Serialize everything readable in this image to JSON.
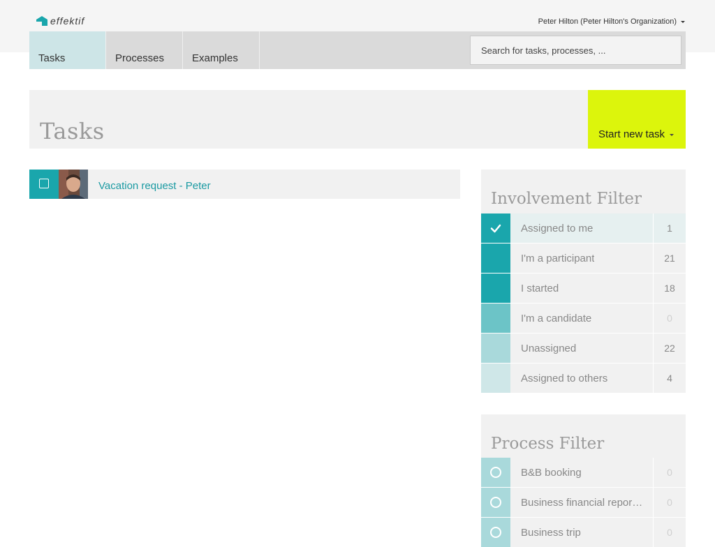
{
  "app": {
    "logo_text": "effektif",
    "user_menu_label": "Peter Hilton (Peter Hilton's Organization)"
  },
  "nav": {
    "tabs": [
      {
        "label": "Tasks",
        "active": true
      },
      {
        "label": "Processes",
        "active": false
      },
      {
        "label": "Examples",
        "active": false
      }
    ],
    "search_placeholder": "Search for tasks, processes, ..."
  },
  "page": {
    "title": "Tasks",
    "start_button_label": "Start new task"
  },
  "tasks": [
    {
      "title": "Vacation request - Peter"
    }
  ],
  "involvement_filter": {
    "title": "Involvement Filter",
    "items": [
      {
        "label": "Assigned to me",
        "count": "1",
        "selected": true,
        "color": "#1aa6ac"
      },
      {
        "label": "I'm a participant",
        "count": "21",
        "selected": false,
        "color": "#1aa6ac"
      },
      {
        "label": "I started",
        "count": "18",
        "selected": false,
        "color": "#1aa6ac"
      },
      {
        "label": "I'm a candidate",
        "count": "0",
        "selected": false,
        "color": "#6cc4c7"
      },
      {
        "label": "Unassigned",
        "count": "22",
        "selected": false,
        "color": "#a9d9db"
      },
      {
        "label": "Assigned to others",
        "count": "4",
        "selected": false,
        "color": "#cfe7e8"
      }
    ]
  },
  "process_filter": {
    "title": "Process Filter",
    "items": [
      {
        "label": "B&B booking",
        "count": "0",
        "color": "#a9d9db"
      },
      {
        "label": "Business financial repor…",
        "count": "0",
        "color": "#a9d9db"
      },
      {
        "label": "Business trip",
        "count": "0",
        "color": "#a9d9db"
      }
    ]
  },
  "colors": {
    "accent_teal": "#1aa6ac",
    "start_button": "#dcf50c",
    "active_tab": "#cde5e7"
  }
}
